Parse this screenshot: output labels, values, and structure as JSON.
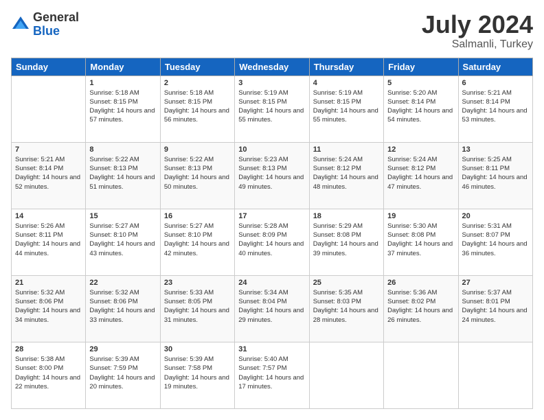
{
  "logo": {
    "general": "General",
    "blue": "Blue"
  },
  "title": "July 2024",
  "subtitle": "Salmanli, Turkey",
  "headers": [
    "Sunday",
    "Monday",
    "Tuesday",
    "Wednesday",
    "Thursday",
    "Friday",
    "Saturday"
  ],
  "weeks": [
    [
      {
        "day": "",
        "sunrise": "",
        "sunset": "",
        "daylight": ""
      },
      {
        "day": "1",
        "sunrise": "Sunrise: 5:18 AM",
        "sunset": "Sunset: 8:15 PM",
        "daylight": "Daylight: 14 hours and 57 minutes."
      },
      {
        "day": "2",
        "sunrise": "Sunrise: 5:18 AM",
        "sunset": "Sunset: 8:15 PM",
        "daylight": "Daylight: 14 hours and 56 minutes."
      },
      {
        "day": "3",
        "sunrise": "Sunrise: 5:19 AM",
        "sunset": "Sunset: 8:15 PM",
        "daylight": "Daylight: 14 hours and 55 minutes."
      },
      {
        "day": "4",
        "sunrise": "Sunrise: 5:19 AM",
        "sunset": "Sunset: 8:15 PM",
        "daylight": "Daylight: 14 hours and 55 minutes."
      },
      {
        "day": "5",
        "sunrise": "Sunrise: 5:20 AM",
        "sunset": "Sunset: 8:14 PM",
        "daylight": "Daylight: 14 hours and 54 minutes."
      },
      {
        "day": "6",
        "sunrise": "Sunrise: 5:21 AM",
        "sunset": "Sunset: 8:14 PM",
        "daylight": "Daylight: 14 hours and 53 minutes."
      }
    ],
    [
      {
        "day": "7",
        "sunrise": "Sunrise: 5:21 AM",
        "sunset": "Sunset: 8:14 PM",
        "daylight": "Daylight: 14 hours and 52 minutes."
      },
      {
        "day": "8",
        "sunrise": "Sunrise: 5:22 AM",
        "sunset": "Sunset: 8:13 PM",
        "daylight": "Daylight: 14 hours and 51 minutes."
      },
      {
        "day": "9",
        "sunrise": "Sunrise: 5:22 AM",
        "sunset": "Sunset: 8:13 PM",
        "daylight": "Daylight: 14 hours and 50 minutes."
      },
      {
        "day": "10",
        "sunrise": "Sunrise: 5:23 AM",
        "sunset": "Sunset: 8:13 PM",
        "daylight": "Daylight: 14 hours and 49 minutes."
      },
      {
        "day": "11",
        "sunrise": "Sunrise: 5:24 AM",
        "sunset": "Sunset: 8:12 PM",
        "daylight": "Daylight: 14 hours and 48 minutes."
      },
      {
        "day": "12",
        "sunrise": "Sunrise: 5:24 AM",
        "sunset": "Sunset: 8:12 PM",
        "daylight": "Daylight: 14 hours and 47 minutes."
      },
      {
        "day": "13",
        "sunrise": "Sunrise: 5:25 AM",
        "sunset": "Sunset: 8:11 PM",
        "daylight": "Daylight: 14 hours and 46 minutes."
      }
    ],
    [
      {
        "day": "14",
        "sunrise": "Sunrise: 5:26 AM",
        "sunset": "Sunset: 8:11 PM",
        "daylight": "Daylight: 14 hours and 44 minutes."
      },
      {
        "day": "15",
        "sunrise": "Sunrise: 5:27 AM",
        "sunset": "Sunset: 8:10 PM",
        "daylight": "Daylight: 14 hours and 43 minutes."
      },
      {
        "day": "16",
        "sunrise": "Sunrise: 5:27 AM",
        "sunset": "Sunset: 8:10 PM",
        "daylight": "Daylight: 14 hours and 42 minutes."
      },
      {
        "day": "17",
        "sunrise": "Sunrise: 5:28 AM",
        "sunset": "Sunset: 8:09 PM",
        "daylight": "Daylight: 14 hours and 40 minutes."
      },
      {
        "day": "18",
        "sunrise": "Sunrise: 5:29 AM",
        "sunset": "Sunset: 8:08 PM",
        "daylight": "Daylight: 14 hours and 39 minutes."
      },
      {
        "day": "19",
        "sunrise": "Sunrise: 5:30 AM",
        "sunset": "Sunset: 8:08 PM",
        "daylight": "Daylight: 14 hours and 37 minutes."
      },
      {
        "day": "20",
        "sunrise": "Sunrise: 5:31 AM",
        "sunset": "Sunset: 8:07 PM",
        "daylight": "Daylight: 14 hours and 36 minutes."
      }
    ],
    [
      {
        "day": "21",
        "sunrise": "Sunrise: 5:32 AM",
        "sunset": "Sunset: 8:06 PM",
        "daylight": "Daylight: 14 hours and 34 minutes."
      },
      {
        "day": "22",
        "sunrise": "Sunrise: 5:32 AM",
        "sunset": "Sunset: 8:06 PM",
        "daylight": "Daylight: 14 hours and 33 minutes."
      },
      {
        "day": "23",
        "sunrise": "Sunrise: 5:33 AM",
        "sunset": "Sunset: 8:05 PM",
        "daylight": "Daylight: 14 hours and 31 minutes."
      },
      {
        "day": "24",
        "sunrise": "Sunrise: 5:34 AM",
        "sunset": "Sunset: 8:04 PM",
        "daylight": "Daylight: 14 hours and 29 minutes."
      },
      {
        "day": "25",
        "sunrise": "Sunrise: 5:35 AM",
        "sunset": "Sunset: 8:03 PM",
        "daylight": "Daylight: 14 hours and 28 minutes."
      },
      {
        "day": "26",
        "sunrise": "Sunrise: 5:36 AM",
        "sunset": "Sunset: 8:02 PM",
        "daylight": "Daylight: 14 hours and 26 minutes."
      },
      {
        "day": "27",
        "sunrise": "Sunrise: 5:37 AM",
        "sunset": "Sunset: 8:01 PM",
        "daylight": "Daylight: 14 hours and 24 minutes."
      }
    ],
    [
      {
        "day": "28",
        "sunrise": "Sunrise: 5:38 AM",
        "sunset": "Sunset: 8:00 PM",
        "daylight": "Daylight: 14 hours and 22 minutes."
      },
      {
        "day": "29",
        "sunrise": "Sunrise: 5:39 AM",
        "sunset": "Sunset: 7:59 PM",
        "daylight": "Daylight: 14 hours and 20 minutes."
      },
      {
        "day": "30",
        "sunrise": "Sunrise: 5:39 AM",
        "sunset": "Sunset: 7:58 PM",
        "daylight": "Daylight: 14 hours and 19 minutes."
      },
      {
        "day": "31",
        "sunrise": "Sunrise: 5:40 AM",
        "sunset": "Sunset: 7:57 PM",
        "daylight": "Daylight: 14 hours and 17 minutes."
      },
      {
        "day": "",
        "sunrise": "",
        "sunset": "",
        "daylight": ""
      },
      {
        "day": "",
        "sunrise": "",
        "sunset": "",
        "daylight": ""
      },
      {
        "day": "",
        "sunrise": "",
        "sunset": "",
        "daylight": ""
      }
    ]
  ]
}
